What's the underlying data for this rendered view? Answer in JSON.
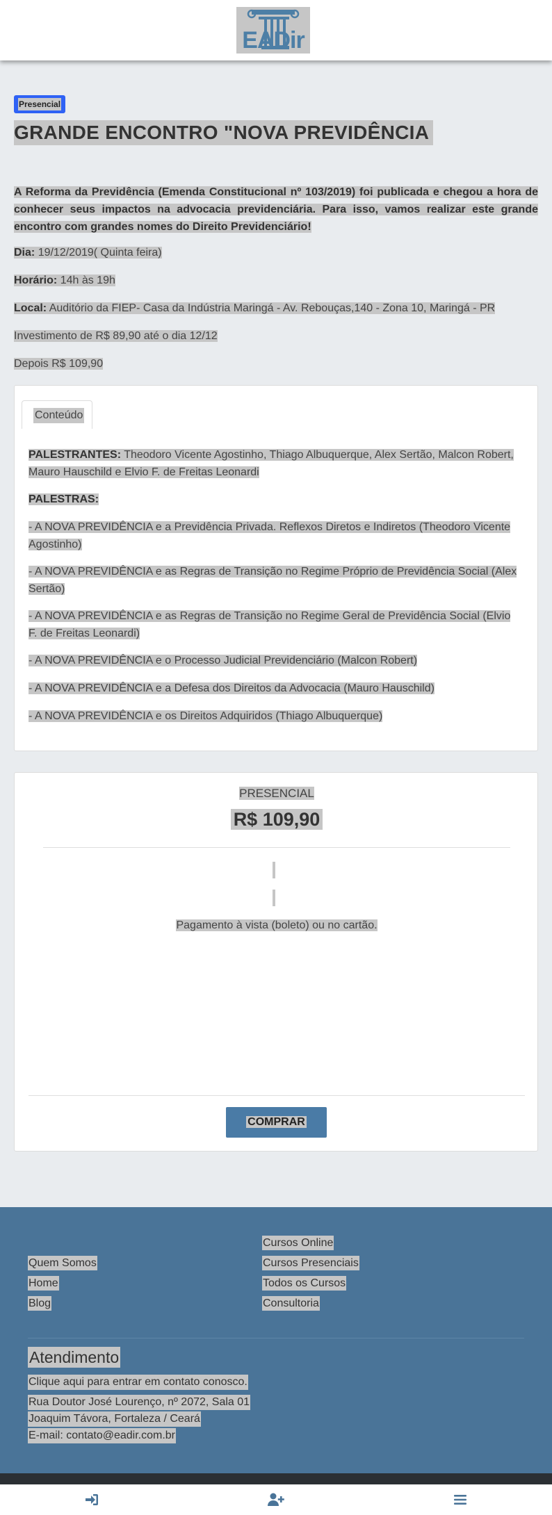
{
  "header": {
    "logo_text": "EADir"
  },
  "event": {
    "badge": "Presencial",
    "title": "GRANDE ENCONTRO \"NOVA PREVIDÊNCIA",
    "intro": "A Reforma da Previdência (Emenda Constitucional nº 103/2019) foi publicada e chegou a hora de conhecer seus impactos na advocacia previdenciária. Para isso, vamos realizar este grande encontro com grandes nomes do Direito Previdenciário!",
    "date_label": "Dia:",
    "date_value": "19/12/2019( Quinta feira)",
    "time_label": "Horário:",
    "time_value": "14h às 19h",
    "place_label": "Local:",
    "place_value": "Auditório da FIEP- Casa da Indústria Maringá - Av. Rebouças,140 - Zona 10, Maringá - PR",
    "investment": "Investimento de R$ 89,90 até o dia 12/12",
    "after": "Depois R$ 109,90"
  },
  "content": {
    "tab_label": "Conteúdo",
    "speakers_label": "PALESTRANTES:",
    "speakers_value": "Theodoro Vicente Agostinho, Thiago Albuquerque, Alex Sertão, Malcon Robert, Mauro Hauschild e Elvio F. de Freitas Leonardi",
    "talks_label": "PALESTRAS:",
    "talks": [
      "- A NOVA PREVIDÊNCIA e a Previdência Privada. Reflexos Diretos e Indiretos (Theodoro Vicente Agostinho)",
      "- A NOVA PREVIDÊNCIA e as Regras de Transição no Regime Próprio de Previdência Social (Alex Sertão)",
      "- A NOVA PREVIDÊNCIA e as Regras de Transição no Regime Geral de Previdência Social (Elvio F. de Freitas Leonardi)",
      "- A NOVA PREVIDÊNCIA e o Processo Judicial Previdenciário (Malcon Robert)",
      "- A NOVA PREVIDÊNCIA e a Defesa dos Direitos da Advocacia (Mauro Hauschild)",
      "- A NOVA PREVIDÊNCIA e os Direitos Adquiridos (Thiago Albuquerque)"
    ]
  },
  "pricing": {
    "mode": "PRESENCIAL",
    "price": "R$ 109,90",
    "payment": "Pagamento à vista (boleto) ou no cartão.",
    "buy_label": "COMPRAR"
  },
  "footer": {
    "left_links": [
      "Quem Somos",
      "Home",
      "Blog"
    ],
    "right_links": [
      "Cursos Online",
      "Cursos Presenciais",
      "Todos os Cursos",
      "Consultoria"
    ],
    "support_title": "Atendimento",
    "contact_link": "Clique aqui para entrar em contato conosco.",
    "address_line1": "Rua Doutor José Lourenço, nº 2072, Sala 01",
    "address_line2": "Joaquim Távora, Fortaleza / Ceará",
    "email": "E-mail: contato@eadir.com.br"
  },
  "bottom_nav": {
    "items": [
      {
        "icon": "sign-in-icon"
      },
      {
        "icon": "user-plus-icon"
      },
      {
        "icon": "menu-icon"
      }
    ]
  },
  "colors": {
    "page_bg": "#e9ecef",
    "badge_bg": "#2f62f5",
    "buy_button": "#4a7ba6",
    "footer_bg": "#4a7498",
    "icon_color": "#4a7498"
  }
}
